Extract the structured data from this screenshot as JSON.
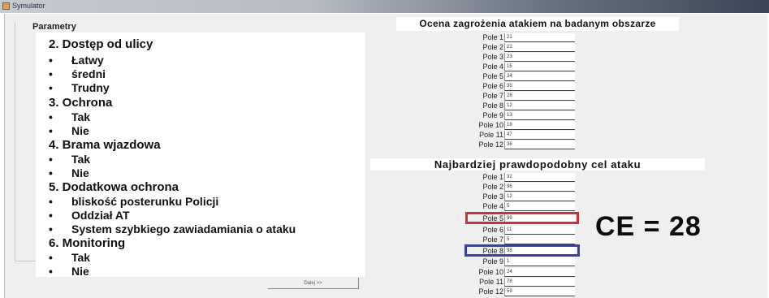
{
  "window": {
    "title": "Symulator"
  },
  "group_title": "Parametry",
  "parameters": {
    "sec2": {
      "heading": "2. Dostęp od ulicy",
      "items": [
        "Łatwy",
        "średni",
        "Trudny"
      ]
    },
    "sec3": {
      "heading": "3. Ochrona",
      "items": [
        "Tak",
        "Nie"
      ]
    },
    "sec4": {
      "heading": "4. Brama wjazdowa",
      "items": [
        "Tak",
        "Nie"
      ]
    },
    "sec5": {
      "heading": "5. Dodatkowa ochrona",
      "items": [
        "bliskość posterunku Policji",
        "Oddział AT",
        "System szybkiego zawiadamiania o ataku"
      ]
    },
    "sec6": {
      "heading": "6. Monitoring",
      "items": [
        "Tak",
        "Nie"
      ]
    }
  },
  "next_button": "Dalej >>",
  "threat": {
    "title": "Ocena zagrożenia atakiem na badanym obszarze",
    "fields": [
      {
        "label": "Pole 1",
        "value": "21"
      },
      {
        "label": "Pole 2",
        "value": "22"
      },
      {
        "label": "Pole 3",
        "value": "23"
      },
      {
        "label": "Pole 4",
        "value": "15"
      },
      {
        "label": "Pole 5",
        "value": "34"
      },
      {
        "label": "Pole 6",
        "value": "35"
      },
      {
        "label": "Pole 7",
        "value": "26"
      },
      {
        "label": "Pole 8",
        "value": "12"
      },
      {
        "label": "Pole 9",
        "value": "13"
      },
      {
        "label": "Pole 10",
        "value": "19"
      },
      {
        "label": "Pole 11",
        "value": "47"
      },
      {
        "label": "Pole 12",
        "value": "36"
      }
    ]
  },
  "target": {
    "title": "Najbardziej prawdopodobny cel ataku",
    "fields": [
      {
        "label": "Pole 1",
        "value": "32"
      },
      {
        "label": "Pole 2",
        "value": "96"
      },
      {
        "label": "Pole 3",
        "value": "12"
      },
      {
        "label": "Pole 4",
        "value": "5"
      },
      {
        "label": "Pole 5",
        "value": "99"
      },
      {
        "label": "Pole 6",
        "value": "11"
      },
      {
        "label": "Pole 7",
        "value": "5"
      },
      {
        "label": "Pole 8",
        "value": "98"
      },
      {
        "label": "Pole 9",
        "value": "1"
      },
      {
        "label": "Pole 10",
        "value": "24"
      },
      {
        "label": "Pole 11",
        "value": "78"
      },
      {
        "label": "Pole 12",
        "value": "59"
      }
    ],
    "highlight_colors": {
      "red": "#c8333b",
      "blue": "#3b3fa6"
    }
  },
  "result": "CE = 28"
}
